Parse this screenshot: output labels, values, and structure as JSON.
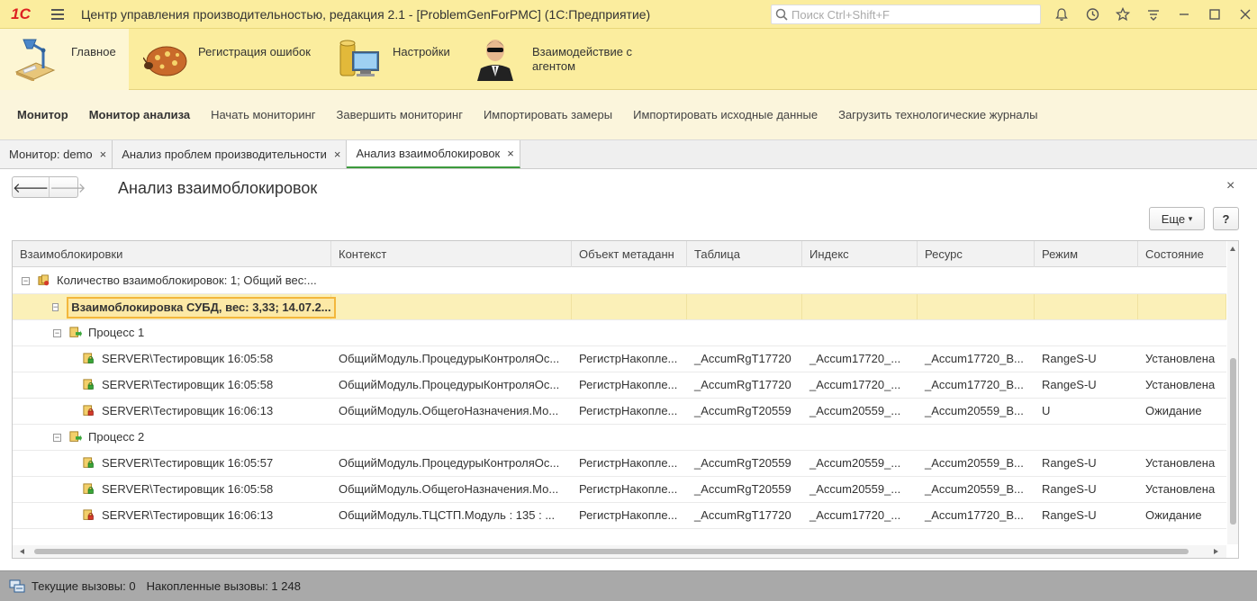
{
  "titlebar": {
    "logo": "1С",
    "title": "Центр управления производительностью, редакция 2.1 - [ProblemGenForPMC]  (1С:Предприятие)",
    "search_placeholder": "Поиск Ctrl+Shift+F"
  },
  "sections": [
    {
      "label": "Главное",
      "icon": "desk-lamp-icon",
      "active": true
    },
    {
      "label": "Регистрация ошибок",
      "icon": "bug-icon",
      "active": false
    },
    {
      "label": "Настройки",
      "icon": "monitor-settings-icon",
      "active": false
    },
    {
      "label_line1": "Взаимодействие с",
      "label_line2": "агентом",
      "icon": "agent-icon",
      "active": false
    }
  ],
  "commands": [
    {
      "label": "Монитор",
      "bold": true
    },
    {
      "label": "Монитор анализа",
      "bold": true
    },
    {
      "label": "Начать мониторинг",
      "bold": false
    },
    {
      "label": "Завершить мониторинг",
      "bold": false
    },
    {
      "label": "Импортировать замеры",
      "bold": false
    },
    {
      "label": "Импортировать исходные данные",
      "bold": false
    },
    {
      "label": "Загрузить технологические журналы",
      "bold": false
    }
  ],
  "tabs": [
    {
      "label": "Монитор: demo",
      "close": "×",
      "active": false
    },
    {
      "label": "Анализ проблем производительности",
      "close": "×",
      "active": false
    },
    {
      "label": "Анализ взаимоблокировок",
      "close": "×",
      "active": true
    }
  ],
  "form": {
    "title": "Анализ взаимоблокировок",
    "back": "🡐",
    "forward": "🡒",
    "close": "×",
    "more_label": "Еще",
    "more_arrow": "▾",
    "help_label": "?"
  },
  "grid": {
    "columns": [
      "Взаимоблокировки",
      "Контекст",
      "Объект метаданн",
      "Таблица",
      "Индекс",
      "Ресурс",
      "Режим",
      "Состояние"
    ],
    "rows": [
      {
        "level": 0,
        "toggle": "⊖",
        "icon": "lock-group-icon",
        "name": "Количество взаимоблокировок: 1; Общий вес:...",
        "context": "",
        "object": "",
        "table": "",
        "index": "",
        "resource": "",
        "mode": "",
        "state": ""
      },
      {
        "level": 1,
        "toggle": "⊖",
        "icon": "",
        "name": "Взаимоблокировка СУБД, вес: 3,33; 14.07.2...",
        "context": "",
        "object": "",
        "table": "",
        "index": "",
        "resource": "",
        "mode": "",
        "state": "",
        "selected": true
      },
      {
        "level": 2,
        "toggle": "⊖",
        "icon": "process-icon",
        "name": "Процесс 1",
        "context": "",
        "object": "",
        "table": "",
        "index": "",
        "resource": "",
        "mode": "",
        "state": ""
      },
      {
        "level": 3,
        "icon": "lock-green-icon",
        "name": "SERVER\\Тестировщик 16:05:58",
        "context": "ОбщийМодуль.ПроцедурыКонтроляОс...",
        "object": "РегистрНакопле...",
        "table": "_AccumRgT17720",
        "index": "_Accum17720_...",
        "resource": "_Accum17720_B...",
        "mode": "RangeS-U",
        "state": "Установлена"
      },
      {
        "level": 3,
        "icon": "lock-green-icon",
        "name": "SERVER\\Тестировщик 16:05:58",
        "context": "ОбщийМодуль.ПроцедурыКонтроляОс...",
        "object": "РегистрНакопле...",
        "table": "_AccumRgT17720",
        "index": "_Accum17720_...",
        "resource": "_Accum17720_B...",
        "mode": "RangeS-U",
        "state": "Установлена"
      },
      {
        "level": 3,
        "icon": "lock-red-icon",
        "name": "SERVER\\Тестировщик 16:06:13",
        "context": "ОбщийМодуль.ОбщегоНазначения.Мо...",
        "object": "РегистрНакопле...",
        "table": "_AccumRgT20559",
        "index": "_Accum20559_...",
        "resource": "_Accum20559_B...",
        "mode": "U",
        "state": "Ожидание"
      },
      {
        "level": 2,
        "toggle": "⊖",
        "icon": "process-icon",
        "name": "Процесс 2",
        "context": "",
        "object": "",
        "table": "",
        "index": "",
        "resource": "",
        "mode": "",
        "state": ""
      },
      {
        "level": 3,
        "icon": "lock-green-icon",
        "name": "SERVER\\Тестировщик 16:05:57",
        "context": "ОбщийМодуль.ПроцедурыКонтроляОс...",
        "object": "РегистрНакопле...",
        "table": "_AccumRgT20559",
        "index": "_Accum20559_...",
        "resource": "_Accum20559_B...",
        "mode": "RangeS-U",
        "state": "Установлена"
      },
      {
        "level": 3,
        "icon": "lock-green-icon",
        "name": "SERVER\\Тестировщик 16:05:58",
        "context": "ОбщийМодуль.ОбщегоНазначения.Мо...",
        "object": "РегистрНакопле...",
        "table": "_AccumRgT20559",
        "index": "_Accum20559_...",
        "resource": "_Accum20559_B...",
        "mode": "RangeS-U",
        "state": "Установлена"
      },
      {
        "level": 3,
        "icon": "lock-red-icon",
        "name": "SERVER\\Тестировщик 16:06:13",
        "context": "ОбщийМодуль.ТЦСТП.Модуль : 135 : ...",
        "object": "РегистрНакопле...",
        "table": "_AccumRgT17720",
        "index": "_Accum17720_...",
        "resource": "_Accum17720_B...",
        "mode": "RangeS-U",
        "state": "Ожидание"
      }
    ]
  },
  "status": {
    "current_calls": "Текущие вызовы: 0",
    "accumulated_calls": "Накопленные вызовы: 1 248"
  },
  "colors": {
    "header_bg": "#fbed9e",
    "selected_row": "#fbf0b8",
    "selection_border": "#f3b73c",
    "active_tab_accent": "#3d9a3d",
    "status_bg": "#a9a9a9"
  }
}
